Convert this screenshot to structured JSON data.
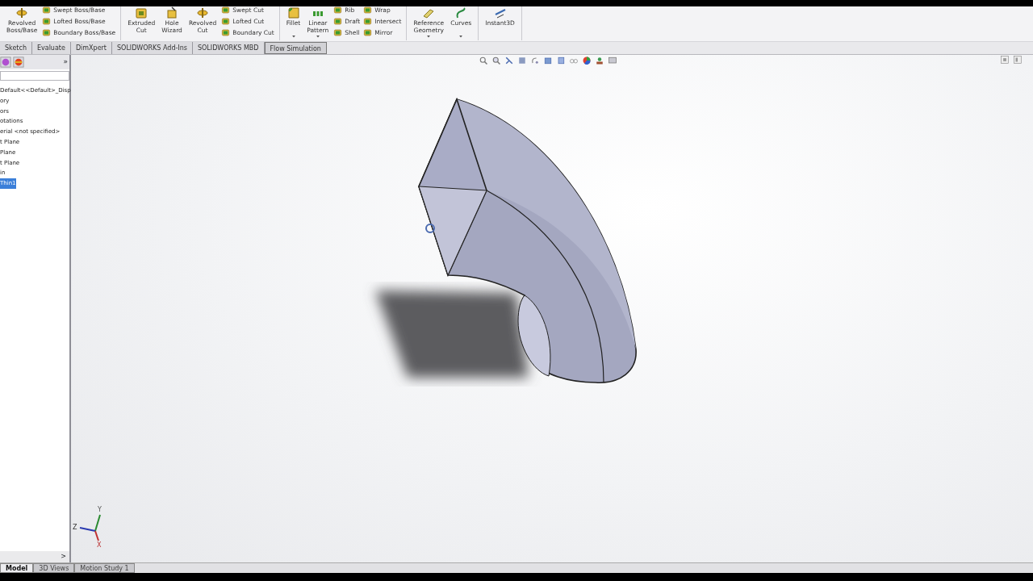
{
  "ribbon": {
    "groups": [
      {
        "large": [
          {
            "label": "Revolved\nBoss/Base"
          }
        ],
        "small": [
          [
            "Swept Boss/Base",
            "Lofted Boss/Base",
            "Boundary Boss/Base"
          ]
        ]
      },
      {
        "large": [
          {
            "label": "Extruded\nCut"
          },
          {
            "label": "Hole\nWizard"
          },
          {
            "label": "Revolved\nCut"
          }
        ],
        "small": [
          [
            "Swept Cut",
            "Lofted Cut",
            "Boundary Cut"
          ]
        ]
      },
      {
        "large": [
          {
            "label": "Fillet",
            "dropdown": true
          },
          {
            "label": "Linear\nPattern",
            "dropdown": true
          }
        ],
        "small": [
          [
            "Rib",
            "Draft",
            "Shell"
          ],
          [
            "Wrap",
            "Intersect",
            "Mirror"
          ]
        ]
      },
      {
        "large": [
          {
            "label": "Reference\nGeometry",
            "dropdown": true
          },
          {
            "label": "Curves",
            "dropdown": true
          }
        ]
      },
      {
        "large": [
          {
            "label": "Instant3D"
          }
        ]
      }
    ]
  },
  "command_tabs": [
    {
      "label": "Sketch",
      "selected": false
    },
    {
      "label": "Evaluate",
      "selected": false
    },
    {
      "label": "DimXpert",
      "selected": false
    },
    {
      "label": "SOLIDWORKS Add-Ins",
      "selected": false
    },
    {
      "label": "SOLIDWORKS MBD",
      "selected": false
    },
    {
      "label": "Flow Simulation",
      "selected": true
    }
  ],
  "panel": {
    "expand": "»",
    "tree": [
      {
        "label": "Default<<Default>_Disp",
        "selected": false
      },
      {
        "label": "ory",
        "selected": false
      },
      {
        "label": "ors",
        "selected": false
      },
      {
        "label": "otations",
        "selected": false
      },
      {
        "label": "erial <not specified>",
        "selected": false
      },
      {
        "label": "t Plane",
        "selected": false
      },
      {
        "label": "Plane",
        "selected": false
      },
      {
        "label": "t Plane",
        "selected": false
      },
      {
        "label": "in",
        "selected": false
      },
      {
        "label": "Thin1",
        "selected": true
      }
    ],
    "scroll_arrow": ">"
  },
  "triad": {
    "x": "X",
    "y": "Y",
    "z": "Z"
  },
  "bottom_tabs": [
    {
      "label": "Model",
      "selected": true
    },
    {
      "label": "3D Views",
      "selected": false
    },
    {
      "label": "Motion Study 1",
      "selected": false
    }
  ]
}
